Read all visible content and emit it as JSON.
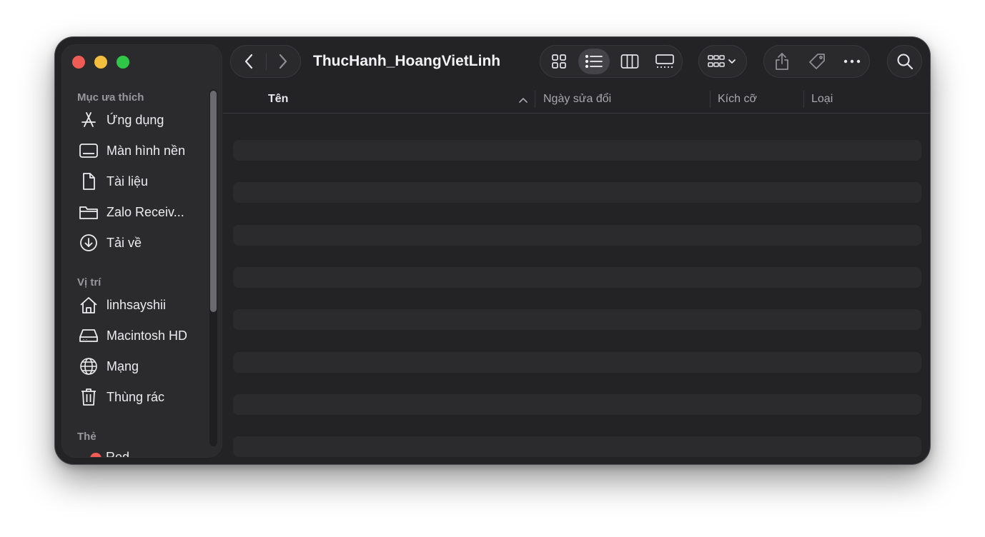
{
  "window": {
    "title": "ThucHanh_HoangVietLinh"
  },
  "sidebar": {
    "favorites_title": "Mục ưa thích",
    "favorites": [
      {
        "label": "Ứng dụng",
        "icon": "applications-icon"
      },
      {
        "label": "Màn hình nền",
        "icon": "desktop-icon"
      },
      {
        "label": "Tài liệu",
        "icon": "document-icon"
      },
      {
        "label": "Zalo Receiv...",
        "icon": "folder-icon"
      },
      {
        "label": "Tải về",
        "icon": "download-icon"
      }
    ],
    "locations_title": "Vị trí",
    "locations": [
      {
        "label": "linhsayshii",
        "icon": "home-icon"
      },
      {
        "label": "Macintosh HD",
        "icon": "hard-drive-icon"
      },
      {
        "label": "Mạng",
        "icon": "network-globe-icon"
      },
      {
        "label": "Thùng rác",
        "icon": "trash-icon"
      }
    ],
    "tags_title": "Thẻ",
    "tags": [
      {
        "label": "Red",
        "color": "#ee5c55"
      }
    ]
  },
  "toolbar": {
    "view_modes": [
      "icon-view",
      "list-view",
      "column-view",
      "gallery-view"
    ],
    "active_view": "list-view",
    "icons": {
      "back": "chevron-left-icon",
      "forward": "chevron-right-icon",
      "group": "group-by-icon",
      "share": "share-icon",
      "tag": "tag-icon",
      "more": "ellipsis-icon",
      "search": "search-icon"
    }
  },
  "columns": {
    "name": "Tên",
    "modified": "Ngày sửa đổi",
    "size": "Kích cỡ",
    "kind": "Loại",
    "sort_indicator": "chevron-up-icon"
  },
  "colors": {
    "window_bg": "#232326",
    "sidebar_bg": "#2b2b2e",
    "close": "#ee5c55",
    "minimize": "#f3bd3d",
    "maximize": "#2fc748"
  }
}
